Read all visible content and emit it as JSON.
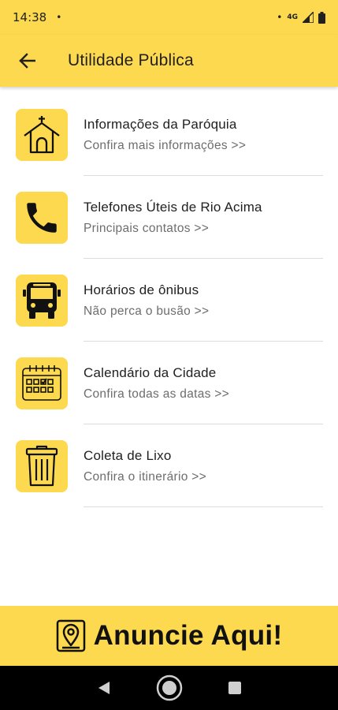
{
  "status_bar": {
    "time": "14:38",
    "notification_dot": "•",
    "network": "4G"
  },
  "app_bar": {
    "title": "Utilidade Pública",
    "back_icon": "arrow-back-icon"
  },
  "items": [
    {
      "title": "Informações da Paróquia",
      "subtitle": "Confira mais informações >>",
      "icon": "church-icon"
    },
    {
      "title": "Telefones Úteis de Rio Acima",
      "subtitle": "Principais contatos >>",
      "icon": "phone-icon"
    },
    {
      "title": "Horários de ônibus",
      "subtitle": "Não perca o busão >>",
      "icon": "bus-icon"
    },
    {
      "title": "Calendário da Cidade",
      "subtitle": "Confira todas as datas >>",
      "icon": "calendar-icon"
    },
    {
      "title": "Coleta de Lixo",
      "subtitle": "Confira o itinerário >>",
      "icon": "trash-icon"
    }
  ],
  "banner": {
    "text": "Anuncie Aqui!",
    "icon": "map-pin-badge-icon"
  },
  "colors": {
    "accent": "#FDD94F",
    "text": "#212121",
    "subtext": "#6d6d6d",
    "navbar": "#000000"
  }
}
